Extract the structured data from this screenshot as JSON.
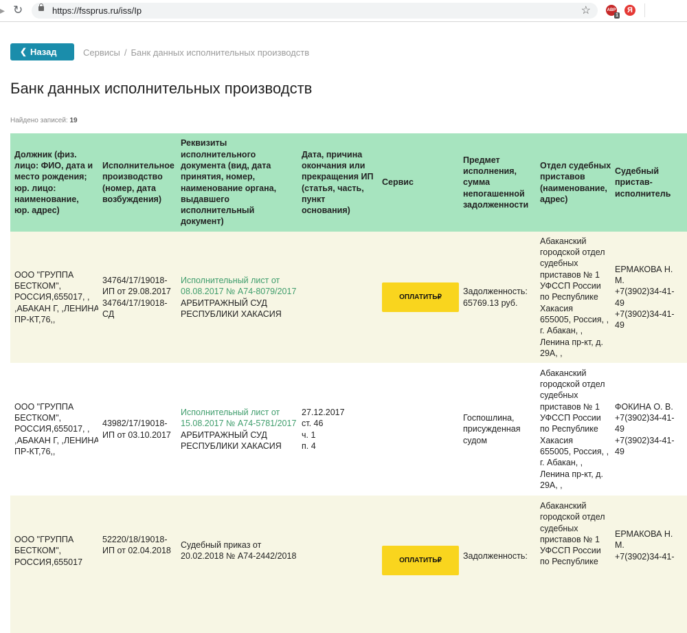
{
  "browser": {
    "url": "https://fssprus.ru/iss/Ip",
    "ext_badge": "ABP",
    "ext_count": "1",
    "ext2": "Я"
  },
  "nav": {
    "back_label": "Назад",
    "breadcrumb": [
      "Сервисы",
      "Банк данных исполнительных производств"
    ]
  },
  "page": {
    "title": "Банк данных исполнительных производств",
    "found_label": "Найдено записей:",
    "found_count": "19"
  },
  "table": {
    "headers": [
      [
        "Должник (физ.",
        "лицо: ФИО, дата и",
        "место рождения;",
        "юр. лицо:",
        "наименование,",
        "юр. адрес)"
      ],
      [
        "Исполнительное",
        "производство",
        "(номер, дата",
        "возбуждения)"
      ],
      [
        "Реквизиты",
        "исполнительного",
        "документа (вид, дата",
        "принятия, номер,",
        "наименование органа,",
        "выдавшего",
        "исполнительный",
        "документ)"
      ],
      [
        "Дата, причина",
        "окончания или",
        "прекращения ИП",
        "(статья, часть,",
        "пункт",
        "основания)"
      ],
      [
        "Сервис"
      ],
      [
        "Предмет",
        "исполнения,",
        "сумма",
        "непогашенной",
        "задолженности"
      ],
      [
        "Отдел судебных",
        "приставов",
        "(наименование,",
        "адрес)"
      ],
      [
        "Судебный",
        "пристав-",
        "исполнитель"
      ]
    ],
    "rows": [
      {
        "debtor": [
          "ООО \"ГРУППА",
          "БЕСТКОМ\",",
          "РОССИЯ,655017, ,",
          ",АБАКАН Г, ,ЛЕНИНА",
          "ПР-КТ,76,,"
        ],
        "proceeding": [
          "34764/17/19018-",
          "ИП от 29.08.2017",
          "34764/17/19018-",
          "СД"
        ],
        "document_link": [
          "Исполнительный лист от",
          "08.08.2017 № А74-8079/2017"
        ],
        "document_issuer": [
          "АРБИТРАЖНЫЙ СУД",
          "РЕСПУБЛИКИ ХАКАСИЯ"
        ],
        "end": [],
        "pay_label": "ОПЛАТИТЬ₽",
        "subject": [
          "Задолженность:",
          "65769.13 руб."
        ],
        "department": [
          "Абаканский",
          "городской отдел",
          "судебных",
          "приставов № 1",
          "УФССП России",
          "по Республике",
          "Хакасия",
          "655005, Россия, , ,",
          "г. Абакан, ,",
          "Ленина пр-кт, д.",
          "29А, ,"
        ],
        "bailiff": [
          "ЕРМАКОВА Н.",
          "М.",
          "+7(3902)34-41-",
          "49",
          "+7(3902)34-41-",
          "49"
        ]
      },
      {
        "debtor": [
          "ООО \"ГРУППА",
          "БЕСТКОМ\",",
          "РОССИЯ,655017, ,",
          ",АБАКАН Г, ,ЛЕНИНА",
          "ПР-КТ,76,,"
        ],
        "proceeding": [
          "43982/17/19018-",
          "ИП от 03.10.2017"
        ],
        "document_link": [
          "Исполнительный лист от",
          "15.08.2017 № А74-5781/2017"
        ],
        "document_issuer": [
          "АРБИТРАЖНЫЙ СУД",
          "РЕСПУБЛИКИ ХАКАСИЯ"
        ],
        "end": [
          "27.12.2017",
          "ст. 46",
          "ч. 1",
          "п. 4"
        ],
        "pay_label": "",
        "subject": [
          "Госпошлина,",
          "присужденная",
          "судом"
        ],
        "department": [
          "Абаканский",
          "городской отдел",
          "судебных",
          "приставов № 1",
          "УФССП России",
          "по Республике",
          "Хакасия",
          "655005, Россия, , ,",
          "г. Абакан, ,",
          "Ленина пр-кт, д.",
          "29А, ,"
        ],
        "bailiff": [
          "ФОКИНА О. В.",
          "+7(3902)34-41-",
          "49",
          "+7(3902)34-41-",
          "49"
        ]
      },
      {
        "debtor": [
          "ООО \"ГРУППА",
          "БЕСТКОМ\",",
          "РОССИЯ,655017"
        ],
        "proceeding": [
          "52220/18/19018-",
          "ИП от 02.04.2018"
        ],
        "document_link": [],
        "document_issuer": [
          "Судебный приказ от",
          "20.02.2018 № А74-2442/2018"
        ],
        "end": [],
        "pay_label": "ОПЛАТИТЬ₽",
        "subject": [
          "Задолженность:"
        ],
        "department": [
          "Абаканский",
          "городской отдел",
          "судебных",
          "приставов № 1",
          "УФССП России",
          "по Республике"
        ],
        "bailiff": [
          "ЕРМАКОВА Н.",
          "М.",
          "+7(3902)34-41-"
        ]
      }
    ]
  }
}
